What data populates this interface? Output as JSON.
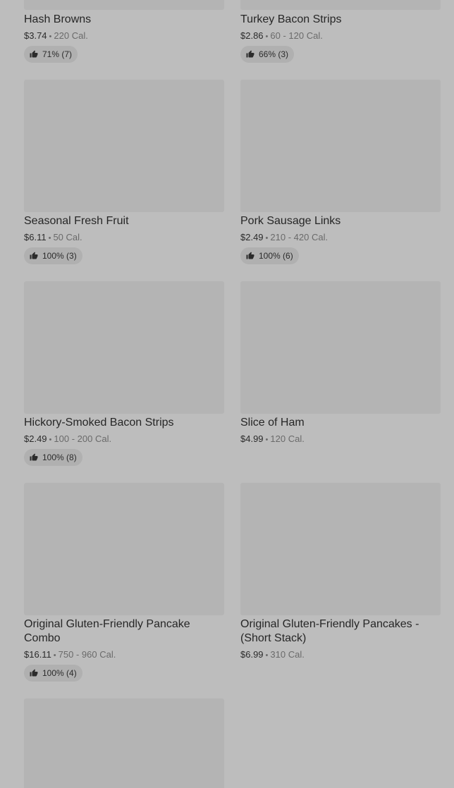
{
  "items": [
    {
      "name": "Hash Browns",
      "price": "$3.74",
      "calories": "220 Cal.",
      "rating": "71% (7)"
    },
    {
      "name": "Turkey Bacon Strips",
      "price": "$2.86",
      "calories": "60 - 120 Cal.",
      "rating": "66% (3)"
    },
    {
      "name": "Seasonal Fresh Fruit",
      "price": "$6.11",
      "calories": "50 Cal.",
      "rating": "100% (3)"
    },
    {
      "name": "Pork Sausage Links",
      "price": "$2.49",
      "calories": "210 - 420 Cal.",
      "rating": "100% (6)"
    },
    {
      "name": "Hickory-Smoked Bacon Strips",
      "price": "$2.49",
      "calories": "100 - 200 Cal.",
      "rating": "100% (8)"
    },
    {
      "name": "Slice of Ham",
      "price": "$4.99",
      "calories": "120 Cal."
    },
    {
      "name": "Original Gluten-Friendly Pancake Combo",
      "price": "$16.11",
      "calories": "750 - 960 Cal.",
      "rating": "100% (4)"
    },
    {
      "name": "Original Gluten-Friendly Pancakes - (Short Stack)",
      "price": "$6.99",
      "calories": "310 Cal."
    },
    {
      "name": ""
    }
  ],
  "separator": "•",
  "icons": {
    "rating": "thumbs-up-icon"
  }
}
